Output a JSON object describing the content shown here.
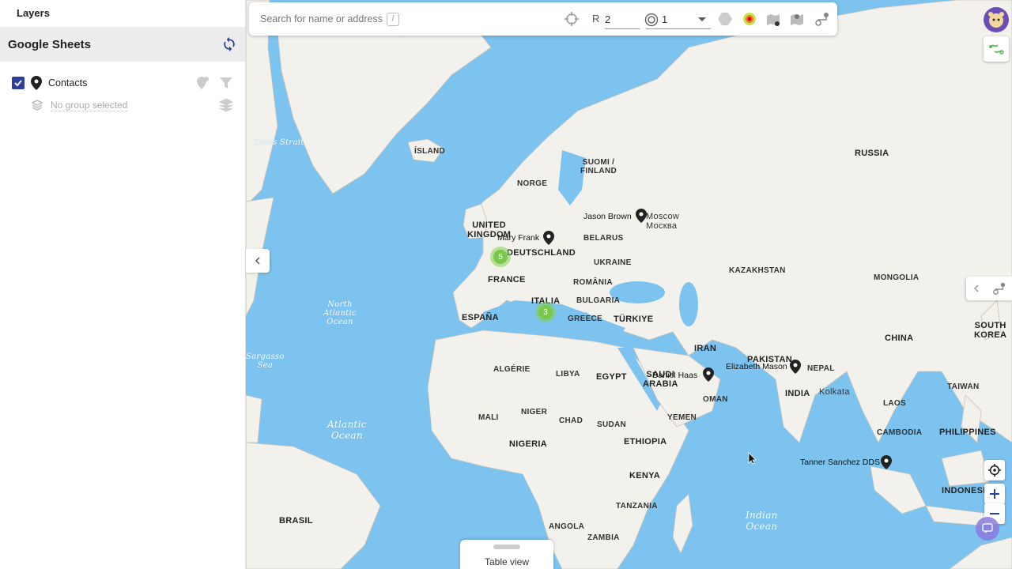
{
  "sidebar": {
    "header": "Layers",
    "section_title": "Google Sheets",
    "layer": {
      "label": "Contacts",
      "checked": true
    },
    "group_placeholder": "No group selected"
  },
  "search": {
    "placeholder": "Search for name or address",
    "shortcut": "/"
  },
  "toolbar": {
    "radius_label": "R",
    "radius_value": "2",
    "rings_value": "1"
  },
  "table_view": {
    "label": "Table view"
  },
  "markers": [
    {
      "name": "Mary Frank"
    },
    {
      "name": "Jason Brown"
    },
    {
      "name": "Daniel Haas"
    },
    {
      "name": "Elizabeth Mason"
    },
    {
      "name": "Tanner Sanchez DDS"
    }
  ],
  "clusters": [
    {
      "count": "5"
    },
    {
      "count": "3"
    }
  ],
  "map_labels": {
    "russia": "RUSSIA",
    "china": "CHINA",
    "india": "INDIA",
    "iran": "IRAN",
    "egypt": "EGYPT",
    "island": "ÍSLAND",
    "norge": "NORGE",
    "suomi": "SUOMI /\nFINLAND",
    "uk": "UNITED\nKINGDOM",
    "deutschland": "DEUTSCHLAND",
    "france": "FRANCE",
    "espana": "ESPAÑA",
    "italia": "ITALIA",
    "turkiye": "TÜRKIYE",
    "ukraine": "UKRAINE",
    "kazakhstan": "KAZAKHSTAN",
    "mongolia": "MONGOLIA",
    "nigeria": "NIGERIA",
    "ethiopia": "ETHIOPIA",
    "kenya": "KENYA",
    "brasil": "BRASIL",
    "indonesia": "INDONESIA",
    "philippines": "PHILIPPINES",
    "pakistan": "PAKISTAN",
    "saudi": "SAUDI\nARABIA",
    "sudan": "SUDAN",
    "libya": "LIBYA",
    "algerie": "ALGÉRIE",
    "mali": "MALI",
    "niger": "NIGER",
    "chad": "CHAD",
    "zambia": "ZAMBIA",
    "angola": "ANGOLA",
    "tanzania": "TANZANIA",
    "greece": "GREECE",
    "bulgaria": "BULGARIA",
    "romania": "ROMÂNIA",
    "belarus": "BELARUS",
    "south_korea": "SOUTH\nKOREA",
    "taiwan": "TAIWAN",
    "cambodia": "CAMBODIA",
    "laos": "LAOS",
    "nepal": "NEPAL",
    "oman": "OMAN",
    "yemen": "YEMEN",
    "moscow": "Moscow\nМосква",
    "kolkata": "Kolkata",
    "north_atlantic": "North\nAtlantic\nOcean",
    "atlantic": "Atlantic\nOcean",
    "indian": "Indian\nOcean",
    "davis": "Davis\nStrait",
    "sargasso": "Sargasso\nSea"
  },
  "colors": {
    "sea": "#7cc3f0",
    "land": "#f3f1ec",
    "accent": "#2c3e9f",
    "cluster": "#7bc74b"
  }
}
